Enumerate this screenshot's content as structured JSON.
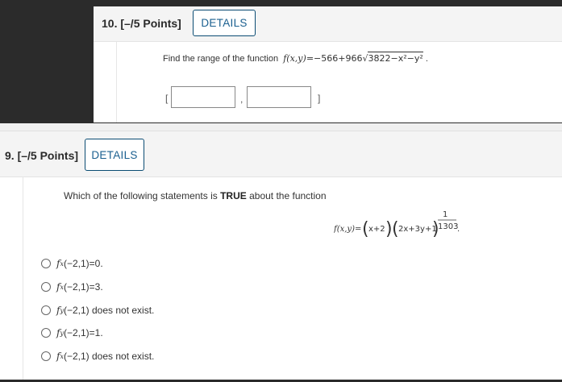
{
  "q10": {
    "header": "10.  [–/5 Points]",
    "details_label": "DETAILS",
    "prompt_text": "Find the range of the function",
    "function_lhs": "f(x,y)",
    "function_mid": "=−566+966",
    "function_radicand": "3822−x²−y²",
    "function_tail": " .",
    "bracket_open": "[",
    "comma": ",",
    "bracket_close": "]",
    "answer_1": "",
    "answer_2": ""
  },
  "q9": {
    "header": "9.  [–/5 Points]",
    "details_label": "DETAILS",
    "prompt_prefix": "Which of the following statements is ",
    "prompt_bold": "TRUE",
    "prompt_suffix": " about the function",
    "function_lhs": "f(x,y)=",
    "factor1": "x+2",
    "factor2": "2x+3y+1",
    "exp_num": "1",
    "exp_den": "1303",
    "options": [
      "f_x(−2,1)=0.",
      "f_x(−2,1)=3.",
      "f_y(−2,1) does not exist.",
      "f_y(−2,1)=1.",
      "f_x(−2,1) does not exist."
    ],
    "option_labels": [
      {
        "sub": "x",
        "rest": "(−2,1)=0."
      },
      {
        "sub": "x",
        "rest": "(−2,1)=3."
      },
      {
        "sub": "y",
        "rest": "(−2,1) does not exist."
      },
      {
        "sub": "y",
        "rest": "(−2,1)=1."
      },
      {
        "sub": "x",
        "rest": "(−2,1) does not exist."
      }
    ]
  },
  "colors": {
    "dark_frame": "#2b2b2b",
    "header_bg": "#f4f4f4",
    "details_border": "#0b4c73",
    "details_text": "#1a5f8f"
  }
}
